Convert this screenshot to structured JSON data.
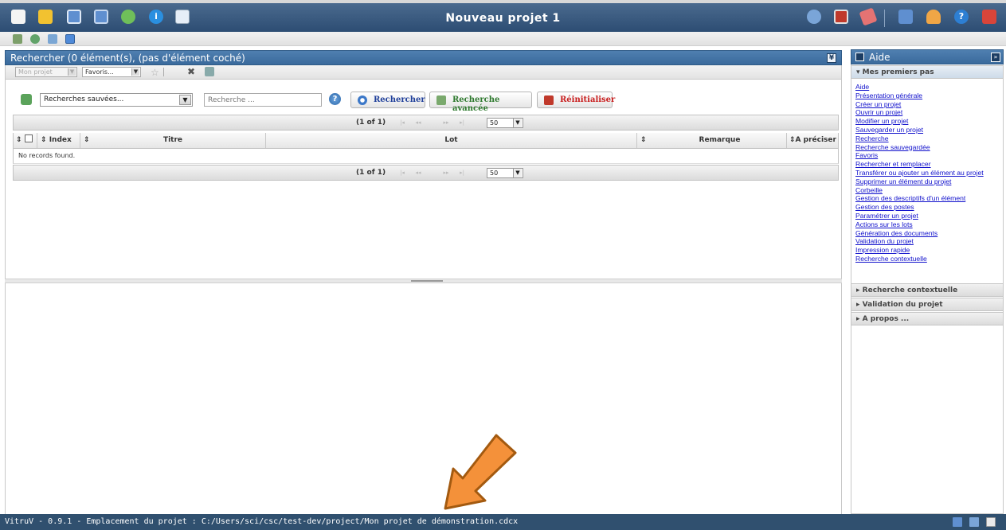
{
  "app": {
    "title": "Nouveau projet 1",
    "accent": "#3a6a9c",
    "toolbar_icons": [
      "new-document-icon",
      "open-folder-icon",
      "save-icon",
      "save-as-icon",
      "recycle-icon",
      "info-icon",
      "settings-doc-icon"
    ],
    "toolbar_right_icons": [
      "home-icon",
      "window-switch-icon",
      "eraser-icon",
      "puzzle-icon",
      "user-icon",
      "help-icon",
      "exit-icon"
    ]
  },
  "search_panel": {
    "header": "Rechercher (0 élément(s), (pas d'élément coché)",
    "project_select": "Mon projet",
    "favorites_select": "Favoris...",
    "saved_searches": "Recherches sauvées...",
    "search_placeholder": "Recherche ...",
    "help_glyph": "?",
    "buttons": {
      "search": "Rechercher",
      "advanced": "Recherche avancée",
      "reset": "Réinitialiser"
    },
    "button_colors": {
      "search": "#1f3f9a",
      "advanced": "#2f7a2f",
      "reset": "#c81d1d"
    }
  },
  "table": {
    "pager_info": "(1 of 1)",
    "page_size": "50",
    "columns": [
      "Index",
      "Titre",
      "Lot",
      "Remarque",
      "A préciser"
    ],
    "empty_message": "No records found."
  },
  "help_panel": {
    "title": "Aide",
    "sections": [
      "Mes premiers pas",
      "Recherche contextuelle",
      "Validation du projet",
      "A propos ..."
    ],
    "links": [
      "Aide",
      "Présentation générale",
      "Créer un projet",
      "Ouvrir un projet",
      "Modifier un projet",
      "Sauvegarder un projet",
      "Recherche",
      "Recherche sauvegardée",
      "Favoris",
      "Rechercher et remplacer",
      "Transférer ou ajouter un élément au projet",
      "Supprimer un élément du projet",
      "Corbeille",
      "Gestion des descriptifs d'un élément",
      "Gestion des postes",
      "Paramétrer un projet",
      "Actions sur les lots",
      "Génération des documents",
      "Validation du projet",
      "Impression rapide",
      "Recherche contextuelle"
    ]
  },
  "status_bar": {
    "text": "VitruV - 0.9.1 - Emplacement du projet : C:/Users/sci/csc/test-dev/project/Mon projet de démonstration.cdcx"
  }
}
